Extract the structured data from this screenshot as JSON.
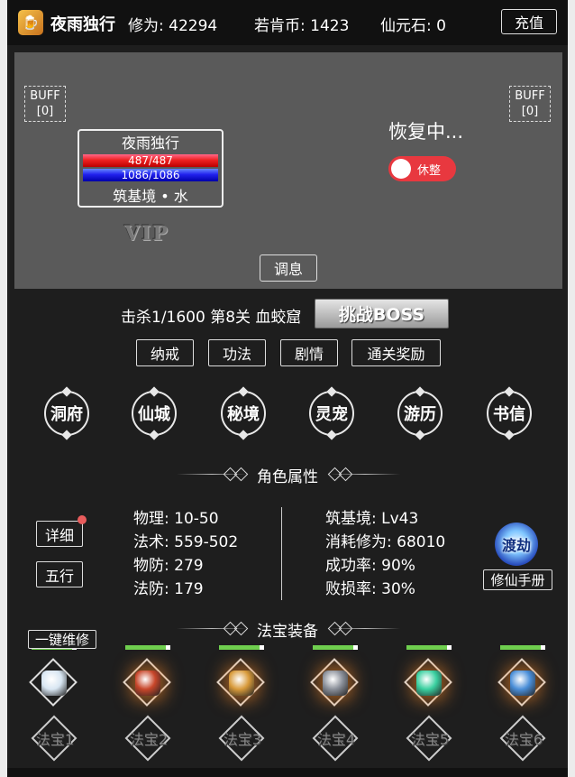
{
  "header": {
    "player_name": "夜雨独行",
    "cultivation": "修为: 42294",
    "coins": "若肯币: 1423",
    "stones": "仙元石: 0",
    "recharge_label": "充值",
    "logo_glyph": "🍺"
  },
  "battle": {
    "buff_left": "BUFF",
    "buff_left_count": "[0]",
    "buff_right": "BUFF",
    "buff_right_count": "[0]",
    "player_card": {
      "name": "夜雨独行",
      "hp": "487/487",
      "mp": "1086/1086",
      "realm": "筑基境 • 水"
    },
    "vip_label": "VIP",
    "recovering_text": "恢复中...",
    "rest_toggle_label": "休整",
    "rest_toggle_on": true,
    "adjust_label": "调息"
  },
  "stage": {
    "kill_text": "击杀1/1600 第8关 血蛟窟",
    "boss_button": "挑战BOSS"
  },
  "tabs": [
    "纳戒",
    "功法",
    "剧情",
    "通关奖励"
  ],
  "places": [
    "洞府",
    "仙城",
    "秘境",
    "灵宠",
    "游历",
    "书信"
  ],
  "attributes": {
    "section_title": "角色属性",
    "detail_button": "详细",
    "five_elements_button": "五行",
    "left": [
      "物理: 10-50",
      "法术: 559-502",
      "物防: 279",
      "法防: 179"
    ],
    "right": [
      "筑基境: Lv43",
      "消耗修为: 68010",
      "成功率: 90%",
      "败损率: 30%"
    ],
    "tribulation_label": "渡劫",
    "manual_button": "修仙手册"
  },
  "equipment": {
    "section_title": "法宝装备",
    "repair_all_label": "一键维修",
    "durability": [
      0.9,
      0.9,
      0.9,
      0.9,
      0.9,
      0.9
    ],
    "items": [
      {
        "icon": "sword-icon",
        "color": "#d8e6f2"
      },
      {
        "icon": "helmet-icon",
        "color": "#c8462a"
      },
      {
        "icon": "armor-icon",
        "color": "#d89a3a"
      },
      {
        "icon": "boots-icon",
        "color": "#8a8f99"
      },
      {
        "icon": "jade-ornament-icon",
        "color": "#3ad0a0"
      },
      {
        "icon": "bracelet-icon",
        "color": "#4a8ed8"
      }
    ],
    "treasures": [
      "法宝1",
      "法宝2",
      "法宝3",
      "法宝4",
      "法宝5",
      "法宝6"
    ]
  }
}
